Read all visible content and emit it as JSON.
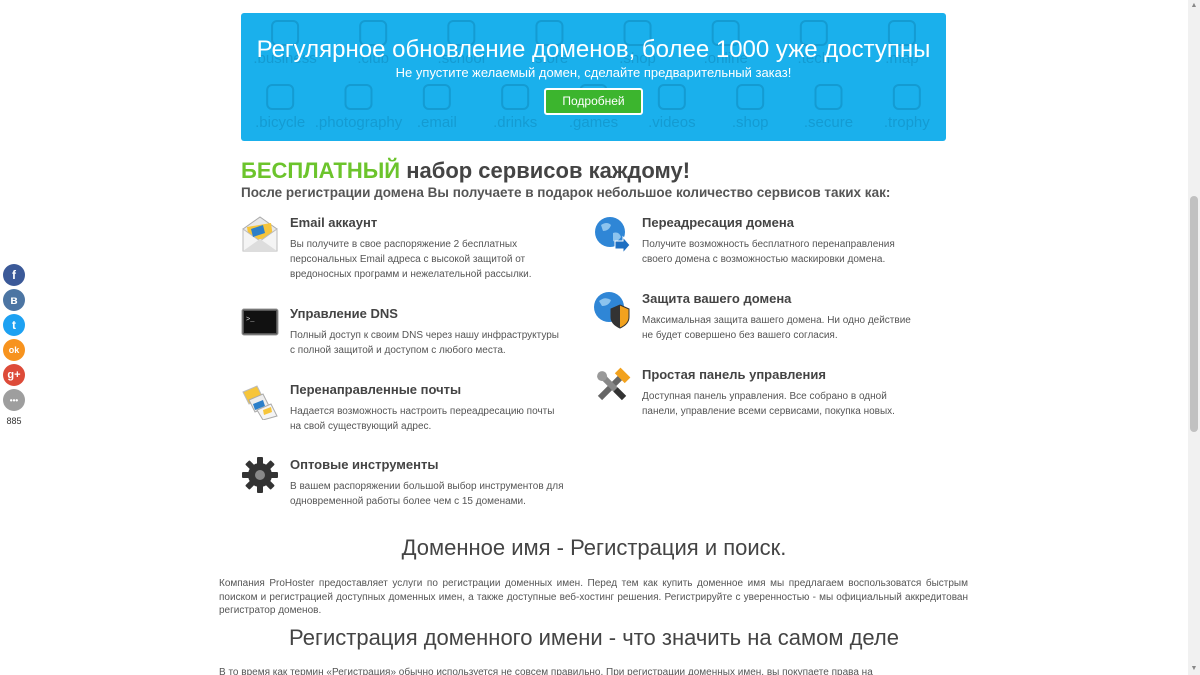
{
  "banner": {
    "title": "Регулярное обновление доменов, более 1000 уже доступны",
    "subtitle": "Не упустите желаемый домен, сделайте предварительный заказ!",
    "button_label": "Подробней",
    "bg_labels": [
      ".business",
      ".club",
      ".school",
      ".store",
      ".shop",
      ".online",
      ".tech",
      ".map",
      ".bicycle",
      ".photography",
      ".email",
      ".drinks",
      ".games",
      ".videos",
      ".shop",
      ".secure",
      ".trophy"
    ]
  },
  "free": {
    "accent": "БЕСПЛАТНЫЙ",
    "heading_rest": " набор сервисов каждому!",
    "subheading": "После регистрации домена Вы получаете в подарок небольшое количество сервисов таких как:"
  },
  "features_left": [
    {
      "icon": "envelope-icon",
      "title": "Email аккаунт",
      "desc": "Вы получите в свое распоряжение 2 бесплатных персональных Email адреса с высокой защитой от вредоносных программ и нежелательной рассылки."
    },
    {
      "icon": "terminal-icon",
      "title": "Управление DNS",
      "desc": "Полный доступ к своим DNS через нашу инфраструктуры с полной защитой и доступом с любого места."
    },
    {
      "icon": "forwarded-mail-icon",
      "title": "Перенаправленные почты",
      "desc": "Надается возможность настроить переадресацию почты на свой существующий адрес."
    },
    {
      "icon": "gear-icon",
      "title": "Оптовые инструменты",
      "desc": "В вашем распоряжении большой выбор инструментов для одновременной работы более чем с 15 доменами."
    }
  ],
  "features_right": [
    {
      "icon": "globe-arrow-icon",
      "title": "Переадресация домена",
      "desc": "Получите возможность бесплатного перенаправления своего домена с возможностью маскировки домена."
    },
    {
      "icon": "globe-shield-icon",
      "title": "Защита вашего домена",
      "desc": "Максимальная защита вашего домена. Ни одно действие не будет совершено без вашего согласия."
    },
    {
      "icon": "tools-icon",
      "title": "Простая панель управления",
      "desc": "Доступная панель управления. Все собрано в одной панели, управление всеми сервисами, покупка новых."
    }
  ],
  "section1": {
    "title": "Доменное имя - Регистрация и поиск.",
    "text": "Компания ProHoster предоставляет услуги по регистрации доменных имен. Перед тем как купить доменное имя мы предлагаем воспользоватся быстрым поиском и регистрацией доступных доменных имен, а также доступные веб-хостинг решения. Регистрируйте с уверенностью - мы официальный аккредитован регистратор доменов."
  },
  "section2": {
    "title": "Регистрация доменного имени - что значить на самом деле",
    "text": "В то время как термин «Регистрация» обычно используется не совсем правильно. При регистрации доменных имен, вы покупаете права на"
  },
  "social": {
    "buttons": [
      {
        "name": "facebook",
        "glyph": "f",
        "color": "#3b5998"
      },
      {
        "name": "vkontakte",
        "glyph": "в",
        "color": "#4c75a3"
      },
      {
        "name": "twitter",
        "glyph": "t",
        "color": "#1da1f2"
      },
      {
        "name": "odnoklassniki",
        "glyph": "ok",
        "color": "#f7931e"
      },
      {
        "name": "google-plus",
        "glyph": "g+",
        "color": "#dd4b39"
      },
      {
        "name": "more",
        "glyph": "•••",
        "color": "#9e9e9e"
      }
    ],
    "count": "885"
  },
  "colors": {
    "banner_bg": "#1ab0ec",
    "button_green": "#3cb52e",
    "accent_green": "#6cc42c"
  }
}
